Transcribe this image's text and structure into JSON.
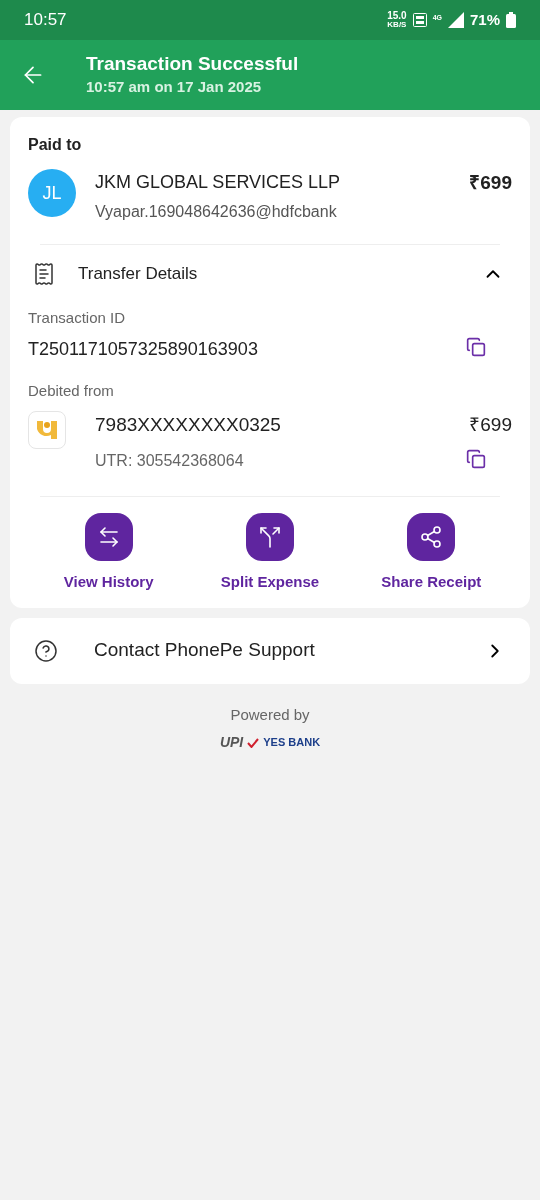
{
  "status_bar": {
    "time": "10:57",
    "speed": "15.0",
    "speed_unit": "KB/S",
    "network": "4G",
    "battery": "71%"
  },
  "header": {
    "title": "Transaction Successful",
    "subtitle": "10:57 am on 17 Jan 2025"
  },
  "paid_to": {
    "label": "Paid to",
    "avatar": "JL",
    "name": "JKM GLOBAL SERVICES LLP",
    "upi_id": "Vyapar.169048642636@hdfcbank",
    "amount": "₹699"
  },
  "transfer_details": {
    "title": "Transfer Details",
    "expanded": true,
    "transaction_id_label": "Transaction ID",
    "transaction_id": "T2501171057325890163903",
    "debited_label": "Debited from",
    "account": "7983XXXXXXXX0325",
    "amount": "₹699",
    "utr": "UTR: 305542368064"
  },
  "actions": [
    {
      "kind": "history",
      "label": "View History"
    },
    {
      "kind": "split",
      "label": "Split Expense"
    },
    {
      "kind": "share",
      "label": "Share Receipt"
    }
  ],
  "support": {
    "label": "Contact PhonePe Support"
  },
  "footer": {
    "powered_by": "Powered by",
    "upi": "UPI",
    "bank": "YES BANK"
  }
}
